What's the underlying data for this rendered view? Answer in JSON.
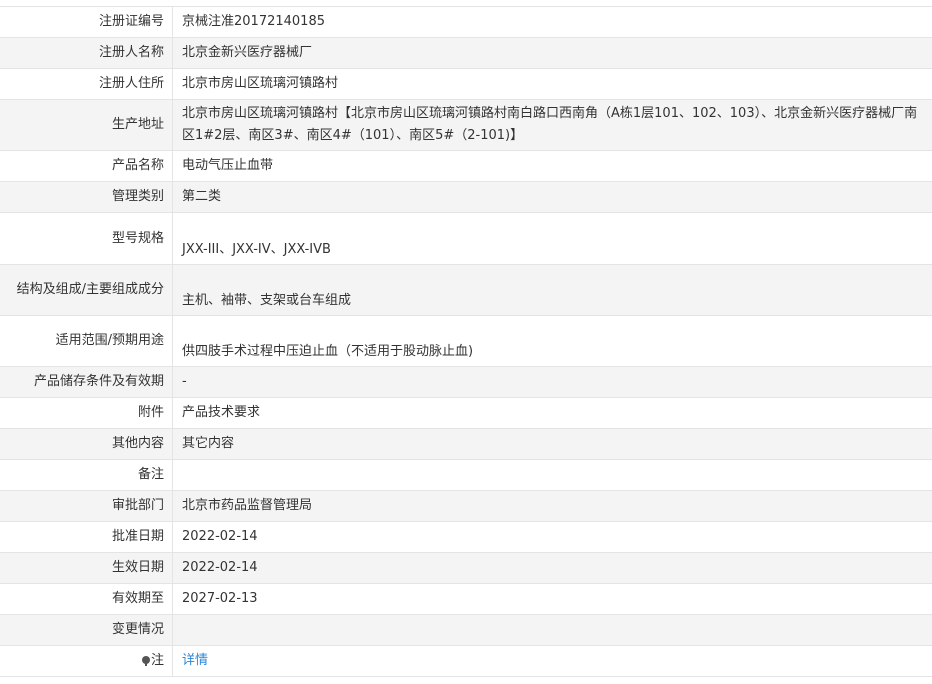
{
  "rows": [
    {
      "label": "注册证编号",
      "value": "京械注准20172140185"
    },
    {
      "label": "注册人名称",
      "value": "北京金新兴医疗器械厂"
    },
    {
      "label": "注册人住所",
      "value": "北京市房山区琉璃河镇路村"
    },
    {
      "label": "生产地址",
      "value": "北京市房山区琉璃河镇路村【北京市房山区琉璃河镇路村南白路口西南角（A栋1层101、102、103）、北京金新兴医疗器械厂南区1#2层、南区3#、南区4#（101）、南区5#（2-101)】"
    },
    {
      "label": "产品名称",
      "value": "电动气压止血带"
    },
    {
      "label": "管理类别",
      "value": "第二类"
    },
    {
      "label": "型号规格",
      "value": "JXX-III、JXX-IV、JXX-IVB"
    },
    {
      "label": "结构及组成/主要组成成分",
      "value": "主机、袖带、支架或台车组成"
    },
    {
      "label": "适用范围/预期用途",
      "value": "供四肢手术过程中压迫止血（不适用于股动脉止血)"
    },
    {
      "label": "产品储存条件及有效期",
      "value": "-"
    },
    {
      "label": "附件",
      "value": "产品技术要求"
    },
    {
      "label": "其他内容",
      "value": "其它内容"
    },
    {
      "label": "备注",
      "value": ""
    },
    {
      "label": "审批部门",
      "value": "北京市药品监督管理局"
    },
    {
      "label": "批准日期",
      "value": "2022-02-14"
    },
    {
      "label": "生效日期",
      "value": "2022-02-14"
    },
    {
      "label": "有效期至",
      "value": "2027-02-13"
    },
    {
      "label": "变更情况",
      "value": ""
    },
    {
      "label": "注",
      "value": "详情"
    }
  ],
  "icons": {
    "remark": "info-bulb-icon"
  },
  "colors": {
    "link": "#2b86d9",
    "stripe": "#f4f4f4",
    "border": "#e4e4e4"
  }
}
